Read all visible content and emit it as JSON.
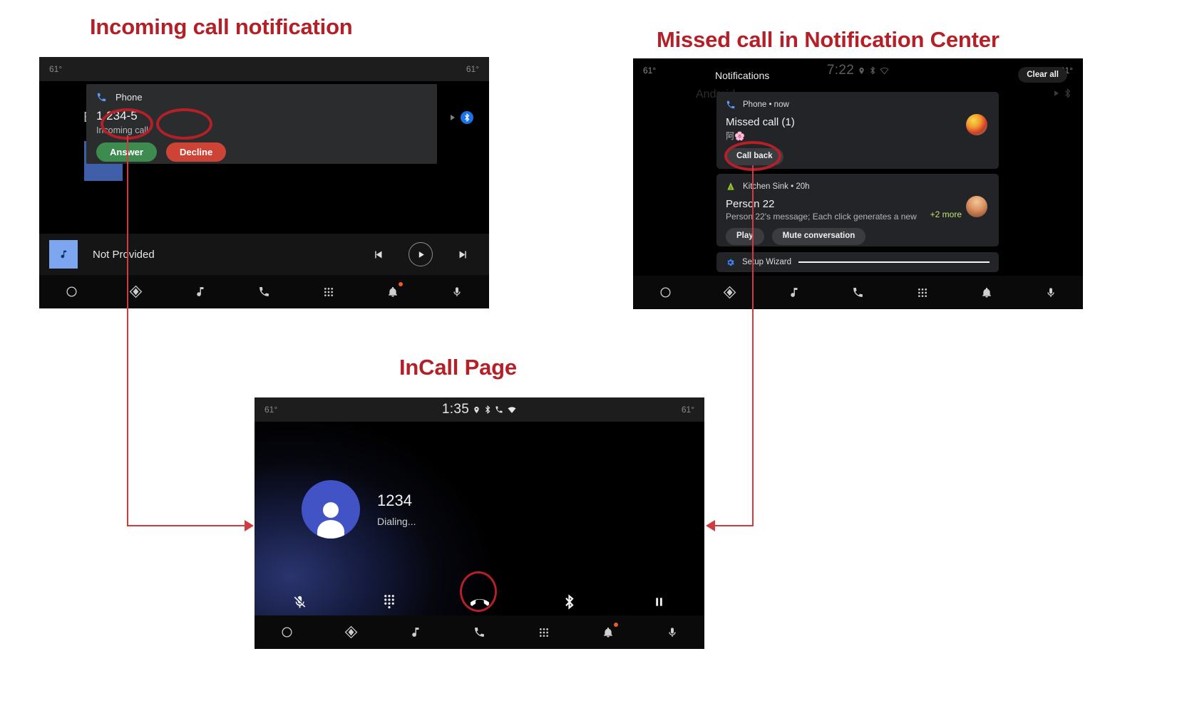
{
  "annotations": {
    "incoming_title": "Incoming call notification",
    "missed_title": "Missed call in Notification Center",
    "incall_title": "InCall Page",
    "accent_color": "#b32028",
    "connector_color": "#cf3b3f"
  },
  "incoming_panel": {
    "status_bar": {
      "temp_left": "61°",
      "temp_right": "61°"
    },
    "background": {
      "letter": "B",
      "bluetooth_icon": "bluetooth-icon"
    },
    "heads_up": {
      "app_icon": "phone-call-icon",
      "app_name": "Phone",
      "title": "1 234-5",
      "subtitle": "Incoming call",
      "answer_label": "Answer",
      "decline_label": "Decline",
      "answer_color": "#3e8b4f",
      "decline_color": "#cd4436"
    },
    "media_bar": {
      "album_icon": "music-note-icon",
      "title": "Not Provided",
      "prev_icon": "skip-previous-icon",
      "play_icon": "play-icon",
      "next_icon": "skip-next-icon"
    },
    "nav_items": [
      {
        "name": "home",
        "icon": "circle-icon"
      },
      {
        "name": "navigation",
        "icon": "navigation-diamond-icon"
      },
      {
        "name": "media",
        "icon": "music-note-icon"
      },
      {
        "name": "phone",
        "icon": "phone-handset-icon"
      },
      {
        "name": "apps",
        "icon": "grid-apps-icon"
      },
      {
        "name": "notifications",
        "icon": "bell-icon",
        "badge": true
      },
      {
        "name": "assistant",
        "icon": "microphone-icon"
      }
    ]
  },
  "missed_panel": {
    "status_bar": {
      "temp_left": "61°",
      "temp_right": "61°",
      "clock": "7:22",
      "icons": [
        "location-icon",
        "bluetooth-icon",
        "wifi-icon"
      ]
    },
    "header_title": "Notifications",
    "clear_all_label": "Clear all",
    "ghost_text": "Android",
    "cards": [
      {
        "app_icon": "phone-call-icon",
        "app_name": "Phone • now",
        "title": "Missed call (1)",
        "subtitle": "阿🌸",
        "actions": [
          "Call back"
        ],
        "avatar": "fruit-avatar"
      },
      {
        "app_icon": "kitchen-sink-icon",
        "app_name": "Kitchen Sink • 20h",
        "title": "Person 22",
        "subtitle": "Person 22's message; Each click generates a new",
        "more_label": "+2 more",
        "actions": [
          "Play",
          "Mute conversation"
        ],
        "avatar": "person-avatar"
      },
      {
        "app_icon": "gear-icon",
        "app_name": "Setup Wizard"
      }
    ],
    "nav_items": [
      {
        "name": "home",
        "icon": "circle-icon"
      },
      {
        "name": "navigation",
        "icon": "navigation-diamond-icon"
      },
      {
        "name": "media",
        "icon": "music-note-icon"
      },
      {
        "name": "phone",
        "icon": "phone-handset-icon"
      },
      {
        "name": "apps",
        "icon": "grid-apps-icon"
      },
      {
        "name": "notifications",
        "icon": "bell-icon",
        "badge": false
      },
      {
        "name": "assistant",
        "icon": "microphone-icon"
      }
    ]
  },
  "incall_panel": {
    "status_bar": {
      "temp_left": "61°",
      "temp_right": "61°",
      "clock": "1:35",
      "icons": [
        "location-icon",
        "bluetooth-icon",
        "phone-forward-icon",
        "wifi-icon"
      ]
    },
    "contact": {
      "avatar_icon": "person-avatar-icon",
      "number": "1234",
      "state": "Dialing..."
    },
    "controls": [
      {
        "name": "mute",
        "icon": "microphone-muted-icon"
      },
      {
        "name": "dialpad",
        "icon": "dialpad-icon"
      },
      {
        "name": "end-call",
        "icon": "end-call-icon",
        "highlighted": true
      },
      {
        "name": "audio-route",
        "icon": "bluetooth-icon"
      },
      {
        "name": "hold",
        "icon": "pause-icon"
      }
    ],
    "nav_items": [
      {
        "name": "home",
        "icon": "circle-icon"
      },
      {
        "name": "navigation",
        "icon": "navigation-diamond-icon"
      },
      {
        "name": "media",
        "icon": "music-note-icon"
      },
      {
        "name": "phone",
        "icon": "phone-handset-icon"
      },
      {
        "name": "apps",
        "icon": "grid-apps-icon"
      },
      {
        "name": "notifications",
        "icon": "bell-icon",
        "badge": true
      },
      {
        "name": "assistant",
        "icon": "microphone-icon"
      }
    ]
  }
}
